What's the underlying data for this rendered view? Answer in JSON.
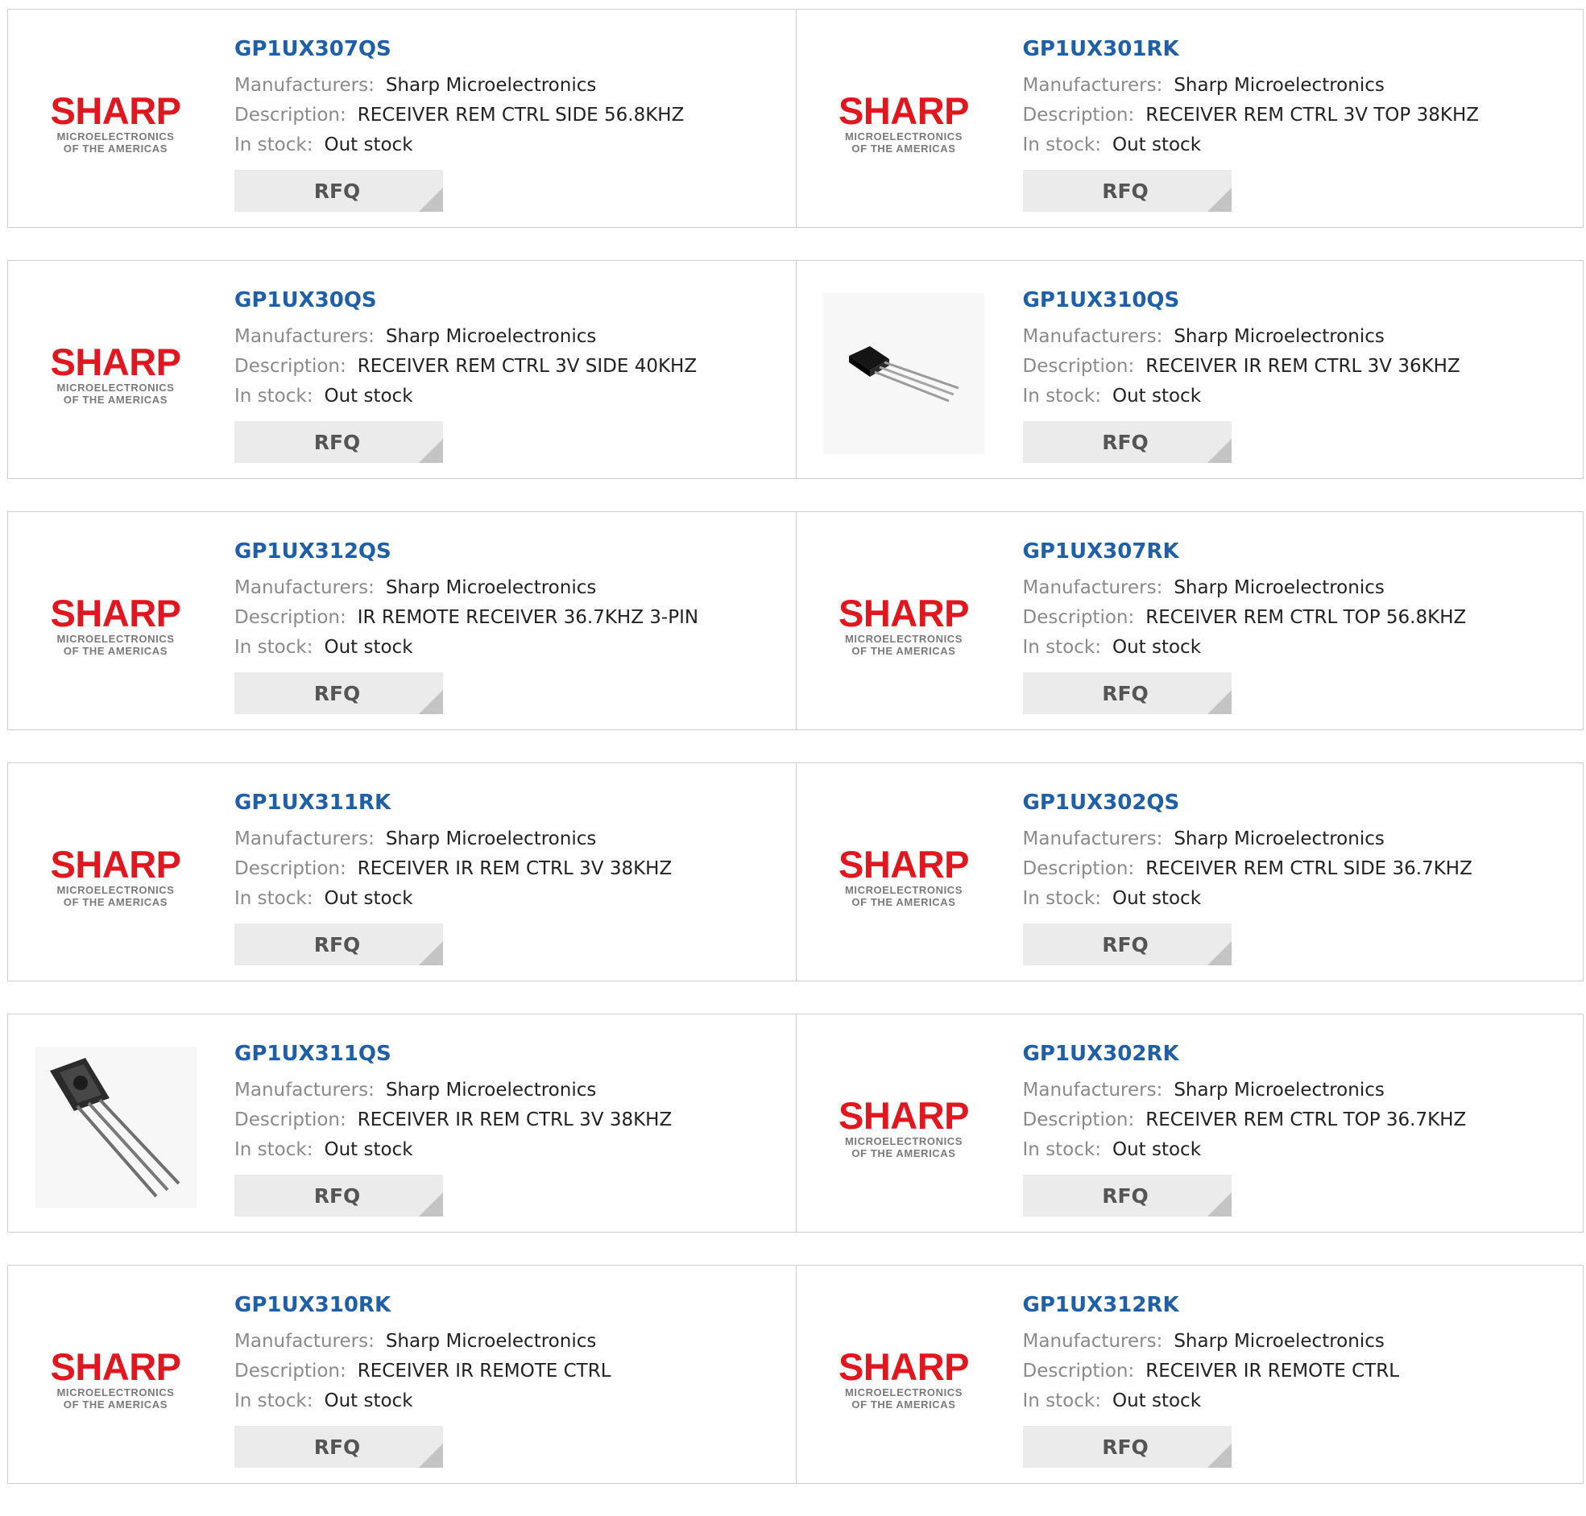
{
  "labels": {
    "manufacturer": "Manufacturers:",
    "description": "Description:",
    "stock": "In stock:",
    "rfq": "RFQ"
  },
  "logo": {
    "word": "SHARP",
    "line1": "MICROELECTRONICS",
    "line2": "OF THE AMERICAS"
  },
  "colors": {
    "part_link": "#1f5fa8",
    "brand_red": "#e1171f",
    "label_gray": "#8a8a8a",
    "button_bg": "#ebebeb"
  },
  "products": [
    {
      "part": "GP1UX307QS",
      "manufacturer": "Sharp Microelectronics",
      "description": "RECEIVER REM CTRL SIDE 56.8KHZ",
      "stock": "Out stock",
      "image": "sharp-logo"
    },
    {
      "part": "GP1UX301RK",
      "manufacturer": "Sharp Microelectronics",
      "description": "RECEIVER REM CTRL 3V TOP 38KHZ",
      "stock": "Out stock",
      "image": "sharp-logo"
    },
    {
      "part": "GP1UX30QS",
      "manufacturer": "Sharp Microelectronics",
      "description": "RECEIVER REM CTRL 3V SIDE 40KHZ",
      "stock": "Out stock",
      "image": "sharp-logo"
    },
    {
      "part": "GP1UX310QS",
      "manufacturer": "Sharp Microelectronics",
      "description": "RECEIVER IR REM CTRL 3V 36KHZ",
      "stock": "Out stock",
      "image": "ir-receiver-side-photo"
    },
    {
      "part": "GP1UX312QS",
      "manufacturer": "Sharp Microelectronics",
      "description": "IR REMOTE RECEIVER 36.7KHZ 3-PIN",
      "stock": "Out stock",
      "image": "sharp-logo"
    },
    {
      "part": "GP1UX307RK",
      "manufacturer": "Sharp Microelectronics",
      "description": "RECEIVER REM CTRL TOP 56.8KHZ",
      "stock": "Out stock",
      "image": "sharp-logo"
    },
    {
      "part": "GP1UX311RK",
      "manufacturer": "Sharp Microelectronics",
      "description": "RECEIVER IR REM CTRL 3V 38KHZ",
      "stock": "Out stock",
      "image": "sharp-logo"
    },
    {
      "part": "GP1UX302QS",
      "manufacturer": "Sharp Microelectronics",
      "description": "RECEIVER REM CTRL SIDE 36.7KHZ",
      "stock": "Out stock",
      "image": "sharp-logo"
    },
    {
      "part": "GP1UX311QS",
      "manufacturer": "Sharp Microelectronics",
      "description": "RECEIVER IR REM CTRL 3V 38KHZ",
      "stock": "Out stock",
      "image": "ir-receiver-front-photo"
    },
    {
      "part": "GP1UX302RK",
      "manufacturer": "Sharp Microelectronics",
      "description": "RECEIVER REM CTRL TOP 36.7KHZ",
      "stock": "Out stock",
      "image": "sharp-logo"
    },
    {
      "part": "GP1UX310RK",
      "manufacturer": "Sharp Microelectronics",
      "description": "RECEIVER IR REMOTE CTRL",
      "stock": "Out stock",
      "image": "sharp-logo"
    },
    {
      "part": "GP1UX312RK",
      "manufacturer": "Sharp Microelectronics",
      "description": "RECEIVER IR REMOTE CTRL",
      "stock": "Out stock",
      "image": "sharp-logo"
    }
  ]
}
